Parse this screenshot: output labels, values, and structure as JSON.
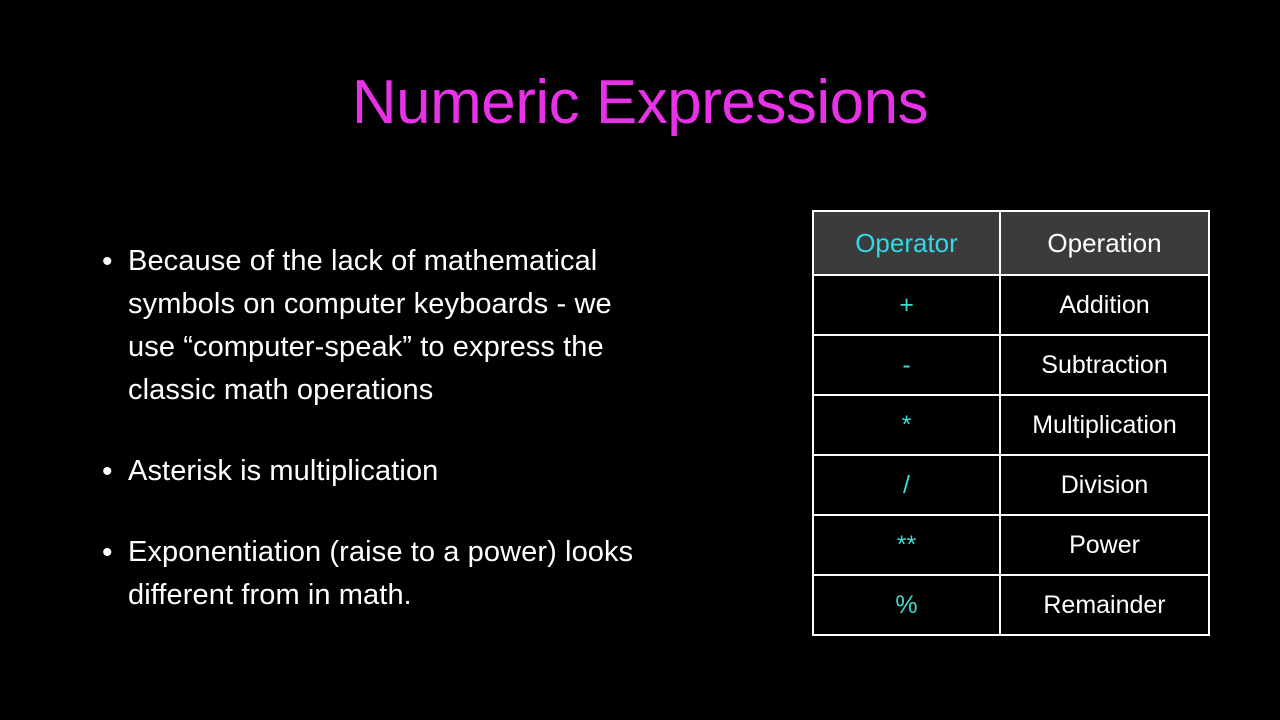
{
  "slide": {
    "title": "Numeric Expressions",
    "title_color": "#e832e8",
    "background_color": "#000000",
    "body_text_color": "#ffffff",
    "accent_cyan": "#3fdcd2",
    "header_cyan": "#2fd9e8",
    "table_header_bg": "#3b3b3b",
    "table_border_color": "#ffffff"
  },
  "bullets": [
    {
      "marker": "•",
      "lines": [
        "Because of the lack of mathematical",
        "symbols on computer keyboards - we",
        "use “computer-speak” to express the",
        "classic math operations"
      ]
    },
    {
      "marker": "•",
      "lines": [
        "Asterisk is multiplication"
      ]
    },
    {
      "marker": "•",
      "lines": [
        "Exponentiation (raise to a power) looks",
        "different from in math."
      ]
    }
  ],
  "table": {
    "headers": [
      "Operator",
      "Operation"
    ],
    "rows": [
      {
        "operator": "+",
        "operation": "Addition"
      },
      {
        "operator": "-",
        "operation": "Subtraction"
      },
      {
        "operator": "*",
        "operation": "Multiplication"
      },
      {
        "operator": "/",
        "operation": "Division"
      },
      {
        "operator": "**",
        "operation": "Power"
      },
      {
        "operator": "%",
        "operation": "Remainder"
      }
    ]
  }
}
